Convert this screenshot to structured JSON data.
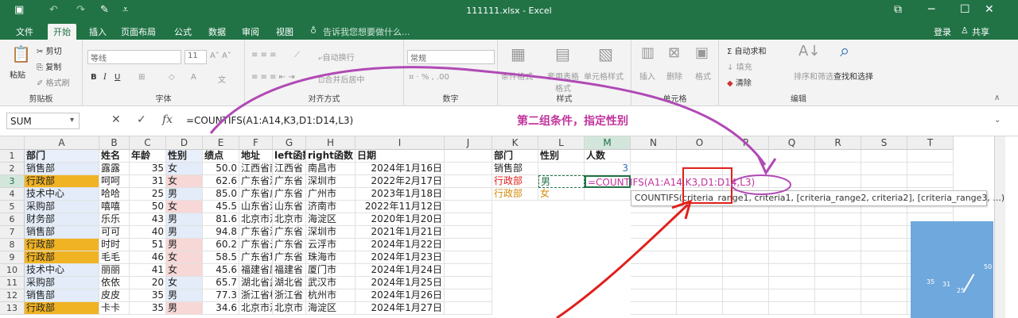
{
  "window": {
    "title": "111111.xlsx - Excel",
    "login": "登录",
    "share": "共享",
    "qa_icons": [
      "save-icon",
      "undo-icon",
      "redo-icon",
      "brush-icon"
    ]
  },
  "tabs": [
    "文件",
    "开始",
    "插入",
    "页面布局",
    "公式",
    "数据",
    "审阅",
    "视图"
  ],
  "tell_me": "告诉我您想要做什么...",
  "ribbon": {
    "paste": "粘贴",
    "cut": "剪切",
    "copy": "复制",
    "format_painter": "格式刷",
    "clipboard": "剪贴板",
    "font_name": "等线",
    "font_size": "11",
    "font": "字体",
    "wrap_text": "自动换行",
    "merge_center": "合并后居中",
    "alignment": "对齐方式",
    "number_format": "常规",
    "number": "数字",
    "cond_format": "条件格式",
    "table_format": "套用表格格式",
    "cell_style": "单元格样式",
    "styles": "样式",
    "insert": "插入",
    "delete": "删除",
    "format": "格式",
    "cells": "单元格",
    "autosum": "自动求和",
    "fill": "填充",
    "clear": "清除",
    "sort_filter": "排序和筛选",
    "find_select": "查找和选择",
    "editing": "编辑"
  },
  "formula_bar": {
    "name_box": "SUM",
    "formula": "=COUNTIFS(A1:A14,K3,D1:D14,L3)"
  },
  "annotation": "第二组条件，指定性别",
  "columns": [
    "A",
    "B",
    "C",
    "D",
    "E",
    "F",
    "G",
    "H",
    "I",
    "J",
    "K",
    "L",
    "M",
    "N",
    "O",
    "P",
    "Q",
    "R",
    "S",
    "T"
  ],
  "rows": [
    "1",
    "2",
    "3",
    "4",
    "5",
    "6",
    "7",
    "8",
    "9",
    "10",
    "11",
    "12",
    "13"
  ],
  "headers": [
    "部门",
    "姓名",
    "年龄",
    "性别",
    "绩点",
    "地址",
    "left函数",
    "right函数",
    "日期"
  ],
  "table": [
    [
      "销售部",
      "露露",
      "35",
      "女",
      "50.0",
      "江西省南昌",
      "江西省",
      "南昌市",
      "2024年1月16日"
    ],
    [
      "行政部",
      "呵呵",
      "31",
      "女",
      "62.6",
      "广东省深圳",
      "广东省",
      "深圳市",
      "2022年2月17日"
    ],
    [
      "技术中心",
      "哈哈",
      "25",
      "男",
      "85.0",
      "广东省广州",
      "广东省",
      "广州市",
      "2023年1月18日"
    ],
    [
      "采购部",
      "嘻嘻",
      "50",
      "女",
      "45.5",
      "山东省济南",
      "山东省",
      "济南市",
      "2022年11月12日"
    ],
    [
      "财务部",
      "乐乐",
      "43",
      "男",
      "81.6",
      "北京市海淀",
      "北京市",
      "海淀区",
      "2020年1月20日"
    ],
    [
      "销售部",
      "可可",
      "40",
      "男",
      "94.8",
      "广东省深圳",
      "广东省",
      "深圳市",
      "2021年1月21日"
    ],
    [
      "行政部",
      "时时",
      "51",
      "男",
      "60.2",
      "广东省云浮",
      "广东省",
      "云浮市",
      "2024年1月22日"
    ],
    [
      "行政部",
      "毛毛",
      "46",
      "女",
      "58.5",
      "广东省珠海",
      "广东省",
      "珠海市",
      "2024年1月23日"
    ],
    [
      "技术中心",
      "丽丽",
      "41",
      "女",
      "45.6",
      "福建省厦门",
      "福建省",
      "厦门市",
      "2024年1月24日"
    ],
    [
      "采购部",
      "依依",
      "20",
      "女",
      "65.7",
      "湖北省武汉",
      "湖北省",
      "武汉市",
      "2024年1月25日"
    ],
    [
      "销售部",
      "皮皮",
      "35",
      "男",
      "77.3",
      "浙江省杭州",
      "浙江省",
      "杭州市",
      "2024年1月26日"
    ],
    [
      "行政部",
      "卡卡",
      "35",
      "男",
      "34.6",
      "北京市海淀",
      "北京市",
      "海淀区",
      "2024年1月27日"
    ]
  ],
  "side": {
    "h": [
      "部门",
      "性别",
      "人数"
    ],
    "r2": [
      "销售部",
      "",
      "3"
    ],
    "r3": [
      "行政部",
      "男",
      "=COUNTIFS(A1:A14,K3,D1:D14,L3)"
    ],
    "r4": [
      "行政部",
      "女",
      ""
    ]
  },
  "tooltip": "COUNTIFS(criteria_range1, criteria1, [criteria_range2, criteria2], [criteria_range3, ...)",
  "thumb_labels": [
    "50",
    "35",
    "31",
    "25"
  ],
  "colors": {
    "excel_green": "#217346",
    "highlight": "#f0b323",
    "annotation": "#c0339c",
    "arrow_red": "#e0201c"
  }
}
